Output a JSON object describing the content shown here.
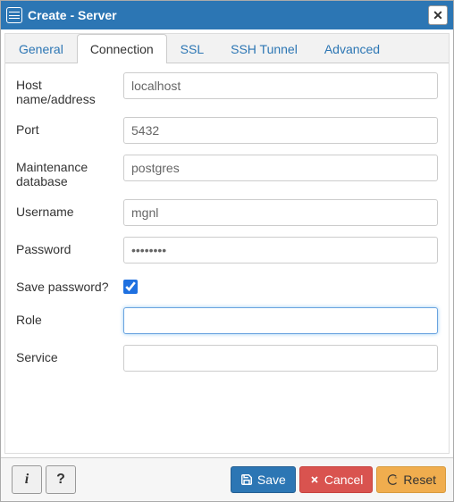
{
  "title": "Create - Server",
  "tabs": {
    "general": "General",
    "connection": "Connection",
    "ssl": "SSL",
    "ssh": "SSH Tunnel",
    "advanced": "Advanced"
  },
  "labels": {
    "host": "Host name/address",
    "port": "Port",
    "maintdb": "Maintenance database",
    "username": "Username",
    "password": "Password",
    "savepw": "Save password?",
    "role": "Role",
    "service": "Service"
  },
  "values": {
    "host": "localhost",
    "port": "5432",
    "maintdb": "postgres",
    "username": "mgnl",
    "password": "••••••••",
    "role": "",
    "service": ""
  },
  "buttons": {
    "info": "i",
    "help": "?",
    "save": "Save",
    "cancel": "Cancel",
    "reset": "Reset"
  }
}
